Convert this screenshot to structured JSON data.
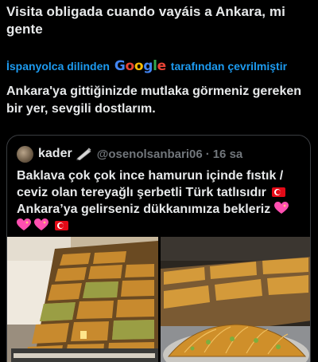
{
  "post": {
    "text": "Visita obligada cuando vayáis a Ankara, mi gente",
    "translated_prefix": "İspanyolca dilinden",
    "translated_brand": "Google",
    "translated_suffix": "tarafından çevrilmiştir",
    "translation": "Ankara'ya gittiğinizde mutlaka görmeniz gereken bir yer, sevgili dostlarım."
  },
  "quote": {
    "name": "kader",
    "handle": "@osenolsanbari06",
    "separator": "·",
    "time": "16 sa",
    "line1": "Baklava çok çok ince hamurun içinde fıstık / ceviz olan tereyağlı şerbetli Türk tatlısıdır",
    "line2": "Ankara’ya gelirseniz  dükkanımıza bekleriz",
    "icons": [
      "pen-icon",
      "turkey-flag-icon",
      "sparkling-heart-icon"
    ],
    "media": [
      "baklava-shop-display-photo",
      "baklava-trays-photo"
    ]
  },
  "colors": {
    "background": "#000000",
    "text": "#e7e9ea",
    "link": "#1d9bf0",
    "muted": "#71767b",
    "border": "#3a3d41"
  }
}
